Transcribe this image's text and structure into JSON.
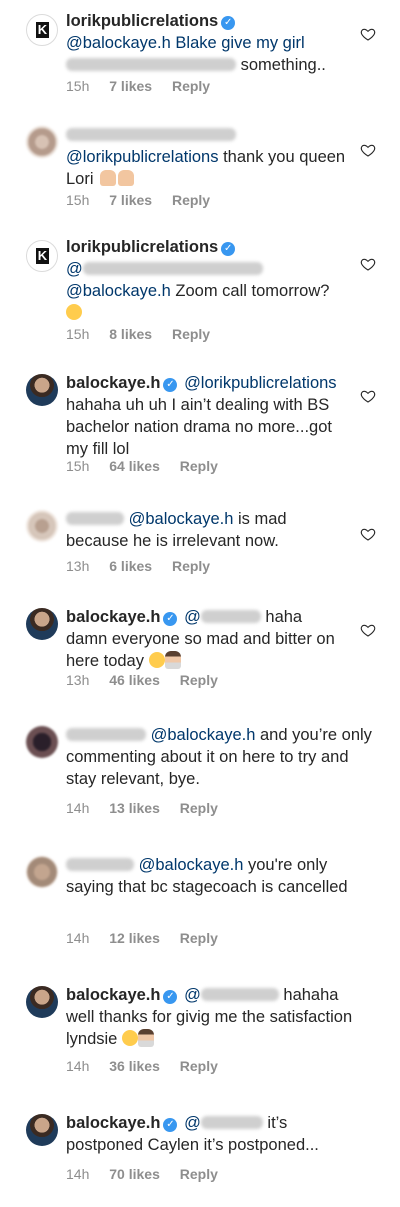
{
  "comments": [
    {
      "avatar": "brand-k-logo",
      "username": "lorikpublicrelations",
      "verified": true,
      "text_before": "@balockaye.h Blake give my girl",
      "text_after": "something..",
      "time": "15h",
      "likes": "7 likes",
      "reply": "Reply"
    },
    {
      "mention": "@lorikpublicrelations",
      "text": "thank you queen Lori",
      "time": "15h",
      "likes": "7 likes",
      "reply": "Reply"
    },
    {
      "username": "lorikpublicrelations",
      "mention": "@balockaye.h",
      "text": "Zoom call tomorrow?",
      "time": "15h",
      "likes": "8 likes",
      "reply": "Reply"
    },
    {
      "username": "balockaye.h",
      "mention": "@lorikpublicrelations",
      "text": "hahaha uh uh I ain’t dealing with BS bachelor nation drama no more...got my fill lol",
      "time": "15h",
      "likes": "64 likes",
      "reply": "Reply"
    },
    {
      "mention": "@balockaye.h",
      "text": "is mad because he is irrelevant now.",
      "time": "13h",
      "likes": "6 likes",
      "reply": "Reply"
    },
    {
      "username": "balockaye.h",
      "text1": "haha",
      "text2": "damn everyone so mad and bitter on here today",
      "time": "13h",
      "likes": "46 likes",
      "reply": "Reply"
    },
    {
      "mention": "@balockaye.h",
      "text": "and you’re only commenting about it on here to try and stay relevant, bye.",
      "time": "14h",
      "likes": "13 likes",
      "reply": "Reply"
    },
    {
      "mention": "@balockaye.h",
      "text": "you're only saying that bc stagecoach is cancelled",
      "time": "14h",
      "likes": "12 likes",
      "reply": "Reply"
    },
    {
      "username": "balockaye.h",
      "text1": "hahaha",
      "text2": "well thanks for givig me the satisfaction lyndsie",
      "time": "14h",
      "likes": "36 likes",
      "reply": "Reply"
    },
    {
      "username": "balockaye.h",
      "text1": "it’s",
      "text2": "postponed Caylen it’s postponed...",
      "time": "14h",
      "likes": "70 likes",
      "reply": "Reply"
    }
  ],
  "colors": {
    "mention": "#00376b",
    "meta": "#8e8e8e",
    "verified": "#3897f0"
  },
  "icons": {
    "like": "heart-outline-icon",
    "verified": "verified-badge-icon"
  }
}
